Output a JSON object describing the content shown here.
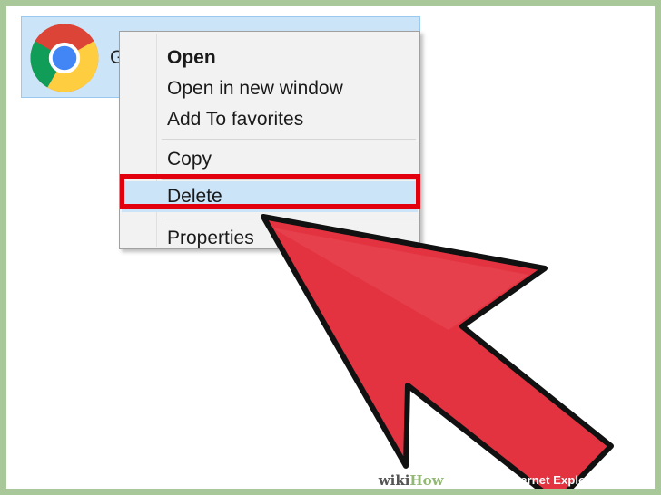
{
  "entry": {
    "label": "G"
  },
  "context_menu": {
    "items": [
      {
        "label": "Open"
      },
      {
        "label": "Open in new window"
      },
      {
        "label": "Add To favorites"
      },
      {
        "label": "Copy"
      },
      {
        "label": "Delete"
      },
      {
        "label": "Properties"
      }
    ]
  },
  "watermark": {
    "wiki": "wiki",
    "how": "How",
    "title": "to Access Internet Explorer History"
  },
  "colors": {
    "highlight_border": "#e3000e",
    "pointer_fill": "#e33340",
    "menu_hover": "#cce4f7",
    "frame": "#a9c89a"
  },
  "icons": {
    "entry_icon": "chrome-icon",
    "pointer": "arrow-pointer-icon"
  }
}
